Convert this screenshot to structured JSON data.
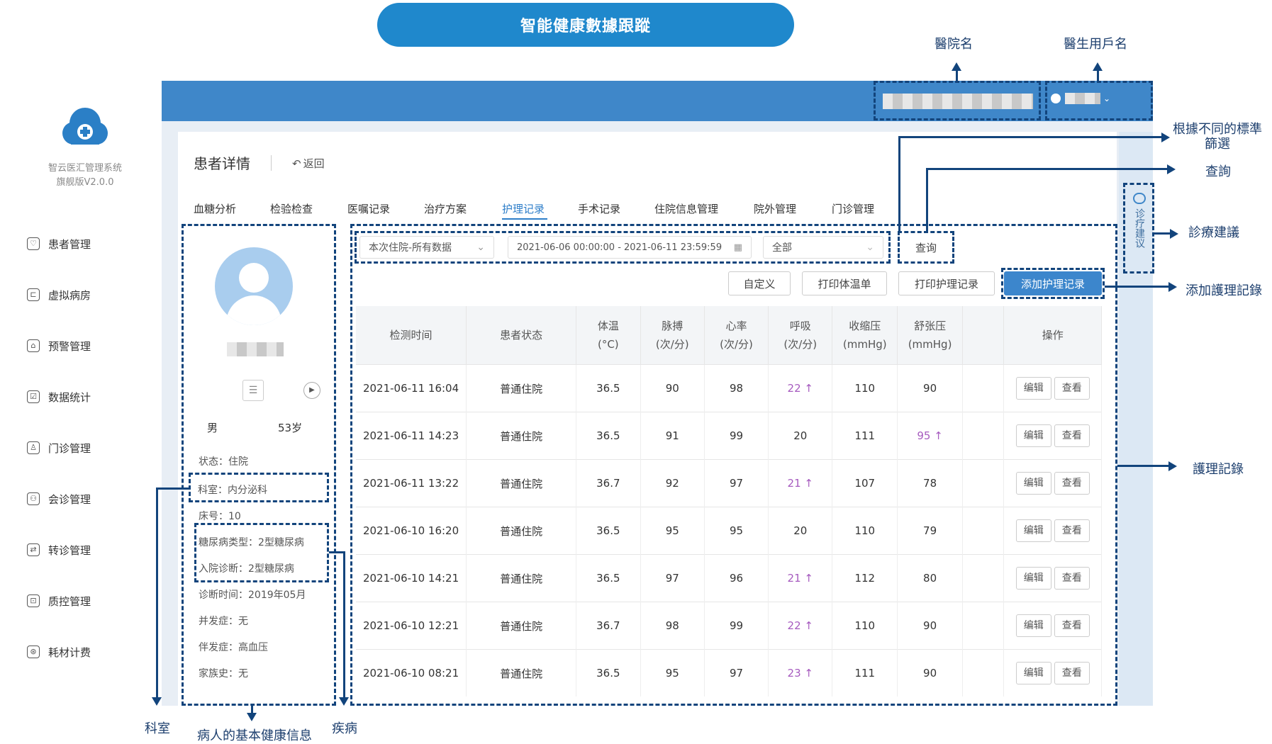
{
  "banner_title": "智能健康數據跟蹤",
  "app": {
    "system_name": "智云医汇管理系统",
    "version": "旗舰版V2.0.0",
    "nav": [
      "患者管理",
      "虚拟病房",
      "预警管理",
      "数据统计",
      "门诊管理",
      "会诊管理",
      "转诊管理",
      "质控管理",
      "耗材计费"
    ],
    "nav_icons": [
      "heart-icon",
      "ward-icon",
      "alarm-icon",
      "stats-icon",
      "outpatient-icon",
      "consult-icon",
      "referral-icon",
      "quality-icon",
      "billing-icon"
    ]
  },
  "page": {
    "title": "患者详情",
    "back": "返回"
  },
  "tabs": [
    "血糖分析",
    "检验检查",
    "医嘱记录",
    "治疗方案",
    "护理记录",
    "手术记录",
    "住院信息管理",
    "院外管理",
    "门诊管理"
  ],
  "active_tab": "护理记录",
  "patient": {
    "gender": "男",
    "age": "53岁",
    "status": "状态：住院",
    "department": "科室：内分泌科",
    "bed": "床号：10",
    "diabetes_type": "糖尿病类型：2型糖尿病",
    "admission_diagnosis": "入院诊断：2型糖尿病",
    "diagnosis_time": "诊断时间：2019年05月",
    "complication": "并发症：无",
    "comorbidity": "伴发症：高血压",
    "family_history": "家族史：无"
  },
  "filters": {
    "scope": "本次住院-所有数据",
    "date_range": "2021-06-06 00:00:00  -  2021-06-11 23:59:59",
    "category": "全部",
    "query": "查询"
  },
  "actions": {
    "custom": "自定义",
    "print_temp": "打印体温单",
    "print_nursing": "打印护理记录",
    "add_nursing": "添加护理记录"
  },
  "side_panel": {
    "label": "诊疗建议"
  },
  "table": {
    "headers": [
      "检测时间",
      "患者状态",
      "体温\n(°C)",
      "脉搏\n(次/分)",
      "心率\n(次/分)",
      "呼吸\n(次/分)",
      "收缩压\n(mmHg)",
      "舒张压\n(mmHg)",
      "",
      "操作"
    ],
    "edit": "编辑",
    "view": "查看",
    "rows": [
      {
        "time": "2021-06-11 16:04",
        "status": "普通住院",
        "temp": "36.5",
        "pulse": "90",
        "hr": "98",
        "resp": "22 ↑",
        "sys": "110",
        "dia": "90",
        "resp_warn": true,
        "dia_warn": false
      },
      {
        "time": "2021-06-11 14:23",
        "status": "普通住院",
        "temp": "36.5",
        "pulse": "91",
        "hr": "99",
        "resp": "20",
        "sys": "111",
        "dia": "95 ↑",
        "resp_warn": false,
        "dia_warn": true
      },
      {
        "time": "2021-06-11 13:22",
        "status": "普通住院",
        "temp": "36.7",
        "pulse": "92",
        "hr": "97",
        "resp": "21 ↑",
        "sys": "107",
        "dia": "78",
        "resp_warn": true,
        "dia_warn": false
      },
      {
        "time": "2021-06-10 16:20",
        "status": "普通住院",
        "temp": "36.5",
        "pulse": "95",
        "hr": "95",
        "resp": "20",
        "sys": "110",
        "dia": "79",
        "resp_warn": false,
        "dia_warn": false
      },
      {
        "time": "2021-06-10 14:21",
        "status": "普通住院",
        "temp": "36.5",
        "pulse": "97",
        "hr": "96",
        "resp": "21 ↑",
        "sys": "112",
        "dia": "80",
        "resp_warn": true,
        "dia_warn": false
      },
      {
        "time": "2021-06-10 12:21",
        "status": "普通住院",
        "temp": "36.7",
        "pulse": "98",
        "hr": "99",
        "resp": "22 ↑",
        "sys": "110",
        "dia": "90",
        "resp_warn": true,
        "dia_warn": false
      },
      {
        "time": "2021-06-10 08:21",
        "status": "普通住院",
        "temp": "36.5",
        "pulse": "95",
        "hr": "97",
        "resp": "23 ↑",
        "sys": "111",
        "dia": "90",
        "resp_warn": true,
        "dia_warn": false
      }
    ]
  },
  "annotations": {
    "hospital_name": "醫院名",
    "doctor_user": "醫生用戶名",
    "filter_criteria": "根據不同的標準篩選",
    "query": "查詢",
    "advice": "診療建議",
    "add_record": "添加護理記錄",
    "nursing_record": "護理記錄",
    "department": "科室",
    "basic_info": "病人的基本健康信息",
    "disease": "疾病"
  },
  "colors": {
    "banner": "#1f88cc",
    "topbar": "#3f87c9",
    "annotation": "#12447c",
    "active_tab": "#2e7ec9",
    "warning": "#a65bbf",
    "primary_button": "#3c86cc"
  }
}
